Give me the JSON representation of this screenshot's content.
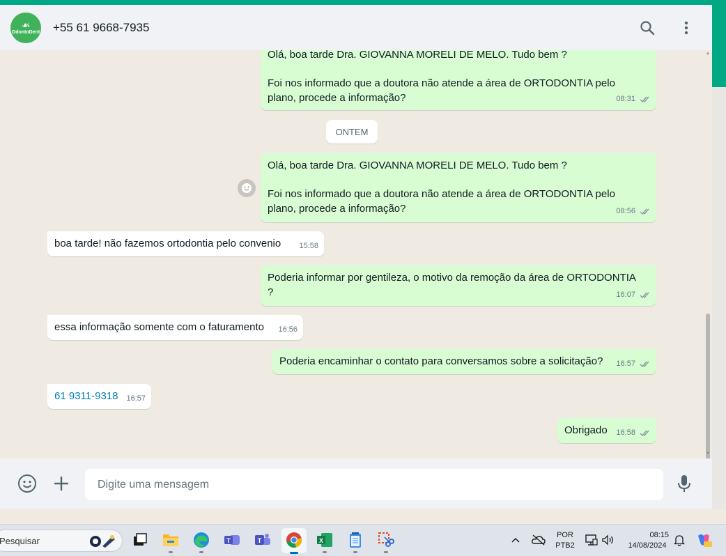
{
  "header": {
    "avatar_text": "OdontoDent",
    "contact": "+55 61 9668-7935",
    "icons": [
      "search-icon",
      "menu-dots-icon"
    ]
  },
  "chat": {
    "date_separator": "ONTEM",
    "messages": [
      {
        "dir": "out",
        "line1": "Olá, boa tarde Dra. GIOVANNA MORELI DE MELO. Tudo bem ?",
        "line2": "Foi nos informado que a doutora não atende a área de ORTODONTIA pelo",
        "line3": "plano, procede a informação?",
        "time": "08:31",
        "status": "read"
      },
      {
        "dir": "out",
        "line1": "Olá, boa tarde Dra. GIOVANNA MORELI DE MELO. Tudo bem ?",
        "line2": "Foi nos informado que a doutora não atende a área de ORTODONTIA pelo",
        "line3": "plano, procede a informação?",
        "time": "08:56",
        "status": "read"
      },
      {
        "dir": "in",
        "text": "boa tarde! não fazemos ortodontia pelo convenio",
        "time": "15:58"
      },
      {
        "dir": "out",
        "line1": "Poderia informar por gentileza, o motivo da remoção da área de ORTODONTIA",
        "line2": "?",
        "time": "16:07",
        "status": "read"
      },
      {
        "dir": "in",
        "text": "essa informação somente com o faturamento",
        "time": "16:56"
      },
      {
        "dir": "out",
        "text": "Poderia encaminhar o contato para conversamos sobre a solicitação?",
        "time": "16:57",
        "status": "read"
      },
      {
        "dir": "in",
        "text": "61 9311-9318",
        "time": "16:57"
      },
      {
        "dir": "out",
        "text": "Obrigado",
        "time": "16:58",
        "status": "read"
      }
    ]
  },
  "composer": {
    "placeholder": "Digite uma mensagem",
    "icons": [
      "emoji-icon",
      "attach-plus-icon",
      "microphone-icon"
    ]
  },
  "taskbar": {
    "search_label": "Pesquisar",
    "apps": [
      "task-view",
      "file-explorer",
      "edge",
      "teams",
      "teams-classic",
      "chrome",
      "excel",
      "notepad",
      "snipping-tool"
    ],
    "lang_line1": "POR",
    "lang_line2": "PTB2",
    "time": "08:15",
    "date": "14/08/2024"
  },
  "colors": {
    "brand_green": "#00a884",
    "outgoing_bubble": "#d9fdd3",
    "incoming_bubble": "#ffffff",
    "chat_background": "#efeae2",
    "read_ticks": "#8696a0",
    "link": "#027eb5"
  }
}
